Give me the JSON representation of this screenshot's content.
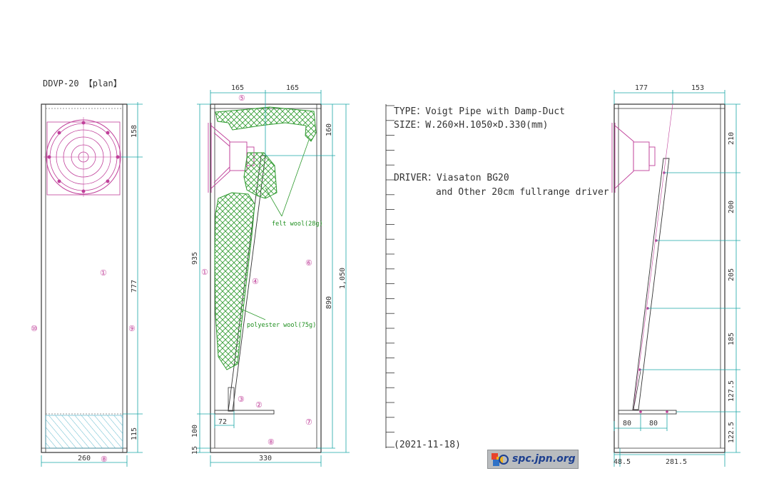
{
  "title": "DDVP-20 【plan】",
  "specs": {
    "type": "TYPE：Voigt Pipe with Damp-Duct",
    "size": "SIZE：W.260×H.1050×D.330(mm)",
    "driver": "DRIVER：Viasaton BG20",
    "driver_alt": "and Other 20cm fullrange driver",
    "date": "(2021-11-18)"
  },
  "front_view": {
    "top_dims": [
      "158",
      "777",
      "115"
    ],
    "bottom_dim": "260",
    "parts": [
      "①",
      "⑨",
      "⑩",
      "⑧"
    ]
  },
  "side_view": {
    "top_dims": [
      "165",
      "165"
    ],
    "left_dims": [
      "935",
      "100",
      "15"
    ],
    "right_dims": [
      "160",
      "890",
      "1,050"
    ],
    "small_dim": "72",
    "bottom_dim": "330",
    "parts": [
      "⑤",
      "①",
      "④",
      "③",
      "②",
      "⑥",
      "⑦",
      "⑧"
    ],
    "notes": [
      "felt wool(28g)",
      "polyester wool(75g)"
    ]
  },
  "section_view": {
    "top_dims": [
      "177",
      "153"
    ],
    "right_dims": [
      "210",
      "200",
      "205",
      "185",
      "127.5",
      "122.5"
    ],
    "duct_dims": [
      "80",
      "80"
    ],
    "bottom_dims": [
      "48.5",
      "281.5"
    ]
  },
  "logo": {
    "text": "spc.jpn.org"
  },
  "colors": {
    "line": "#333333",
    "dimension": "#1aa6a6",
    "driver": "#c0409a",
    "wool": "#2e9a2e",
    "hatch": "#3aa8c0"
  }
}
